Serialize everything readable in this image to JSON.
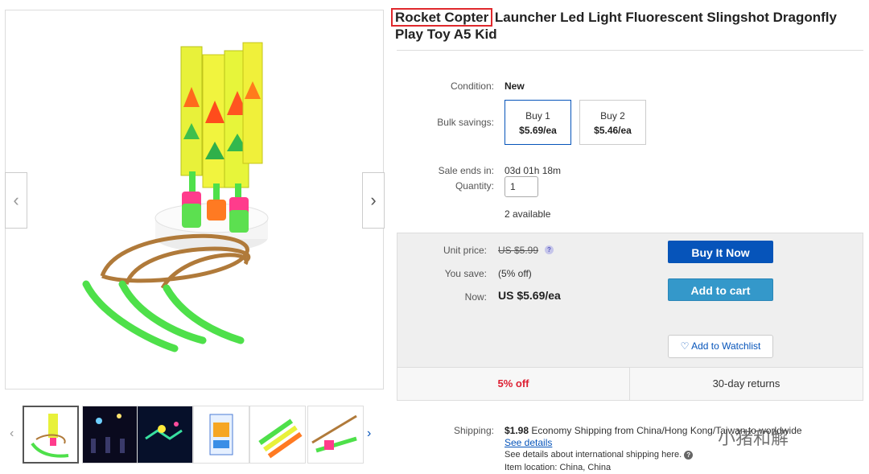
{
  "title": {
    "highlighted": "Rocket Copter",
    "rest": " Launcher Led Light Fluorescent Slingshot Dragonfly Play Toy A5 Kid"
  },
  "details": {
    "condition_label": "Condition:",
    "condition_value": "New",
    "bulk_label": "Bulk savings:",
    "bulk_options": [
      {
        "qty": "Buy 1",
        "price": "$5.69/ea"
      },
      {
        "qty": "Buy 2",
        "price": "$5.46/ea"
      }
    ],
    "sale_ends_label": "Sale ends in:",
    "sale_ends_value": "03d 01h 18m",
    "quantity_label": "Quantity:",
    "quantity_value": "1",
    "available": "2 available"
  },
  "buy_box": {
    "unit_price_label": "Unit price:",
    "unit_price_value": "US $5.99",
    "you_save_label": "You save:",
    "you_save_value": "(5% off)",
    "now_label": "Now:",
    "now_value": "US $5.69/ea",
    "buy_now": "Buy It Now",
    "add_to_cart": "Add to cart",
    "watchlist": "Add to Watchlist",
    "percent_off": "5% off",
    "returns": "30-day returns"
  },
  "shipping": {
    "label": "Shipping:",
    "cost": "$1.98",
    "method": "Economy Shipping from China/Hong Kong/Taiwan to worldwide",
    "see_details": "See details",
    "international": "See details about international shipping here.",
    "item_location": "Item location:  China, China"
  },
  "watermark": "小猪和解",
  "icons": {
    "prev": "chevron-left-icon",
    "next": "chevron-right-icon",
    "heart": "heart-icon",
    "help": "question-icon"
  },
  "colors": {
    "buy_now": "#0654ba",
    "add_to_cart": "#3498ca",
    "discount": "#dd1e31",
    "highlight": "#e0292d"
  }
}
